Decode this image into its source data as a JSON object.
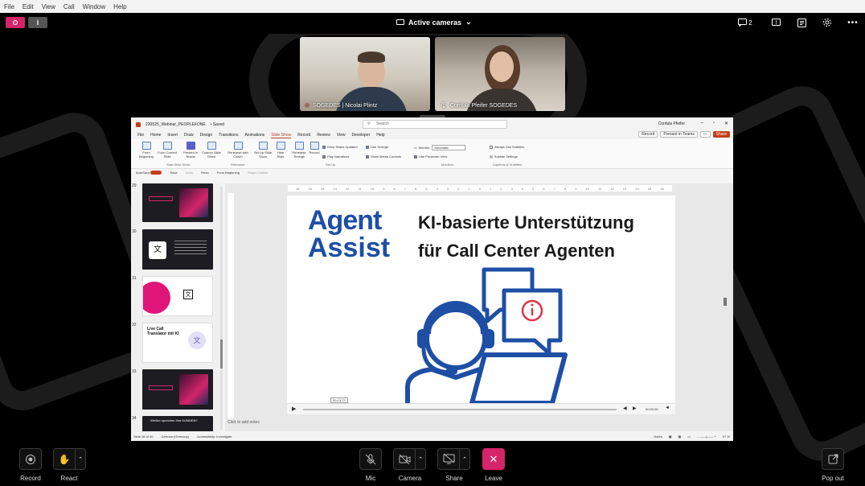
{
  "menubar": {
    "items": [
      "File",
      "Edit",
      "View",
      "Call",
      "Window",
      "Help"
    ]
  },
  "topbar": {
    "active_cameras": "Active cameras",
    "chat_count": "2",
    "info_icon": "i"
  },
  "participants": [
    {
      "name": "SOGEDES | Nicolai Plintz",
      "muted": true
    },
    {
      "name": "Cordula Pfeifer SOGEDES",
      "muted": false
    }
  ],
  "ppt": {
    "filename": "230525_Webinar_PEOPLEFONE",
    "saved": "• Saved",
    "search_placeholder": "Search",
    "user": "Cordula Pfeifer",
    "tabs": [
      "File",
      "Home",
      "Insert",
      "Draw",
      "Design",
      "Transitions",
      "Animations",
      "Slide Show",
      "Record",
      "Review",
      "View",
      "Developer",
      "Help"
    ],
    "active_tab": "Slide Show",
    "record_btn": "Record",
    "present_teams_btn": "Present in Teams",
    "share_btn": "Share",
    "ribbon_items": [
      "From Beginning",
      "From Current Slide",
      "Present in Teams",
      "Custom Slide Show",
      "Rehearse with Coach",
      "Set Up Slide Show",
      "Hide Slide",
      "Rehearse Timings",
      "Record"
    ],
    "ribbon_checks": [
      "Keep Slides Updated",
      "Play Narrations",
      "Use Timings",
      "Show Media Controls",
      "Use Presenter View",
      "Always Use Subtitles"
    ],
    "monitor_label": "Monitor:",
    "monitor_value": "Automatic",
    "subtitle_settings": "Subtitle Settings",
    "groups": [
      "Start Slide Show",
      "Rehearse",
      "Set Up",
      "Monitors",
      "Captions & Subtitles"
    ],
    "quickbar": [
      "AutoSave",
      "Save",
      "Undo",
      "Redo",
      "From Beginning",
      "Shape Outline"
    ],
    "thumb_numbers": [
      "29",
      "30",
      "31",
      "32",
      "33",
      "34"
    ],
    "thumb32_title": "Live Call Translator mit KI",
    "thumb34_title": "Weißer sprechen Ihre KUNDEN?",
    "ruler_ticks": [
      "16",
      "15",
      "14",
      "13",
      "12",
      "11",
      "10",
      "9",
      "8",
      "7",
      "6",
      "5",
      "4",
      "3",
      "2",
      "1",
      "0",
      "1",
      "2",
      "3",
      "4",
      "5",
      "6",
      "7",
      "8",
      "9",
      "10",
      "11",
      "12",
      "13",
      "14",
      "15",
      "16"
    ],
    "slide": {
      "logo_line1": "Agent",
      "logo_line2": "Assist",
      "headline_line1": "KI-basierte Unterstützung",
      "headline_line2": "für Call Center Agenten"
    },
    "media_time_tooltip": "00:13.72",
    "media_time_display": "00:00.00",
    "notes_placeholder": "Click to add notes",
    "status_slide": "Slide 28 of 40",
    "status_language": "German (Germany)",
    "status_accessibility": "Accessibility: Investigate",
    "status_notes": "Notes",
    "status_zoom": "97 %"
  },
  "bottom_bar": {
    "record": "Record",
    "react": "React",
    "mic": "Mic",
    "camera": "Camera",
    "share": "Share",
    "leave": "Leave",
    "pop_out": "Pop out"
  },
  "colors": {
    "accent": "#d4246a",
    "brand_blue": "#1e4fa5",
    "ppt_orange": "#c43e1c"
  }
}
